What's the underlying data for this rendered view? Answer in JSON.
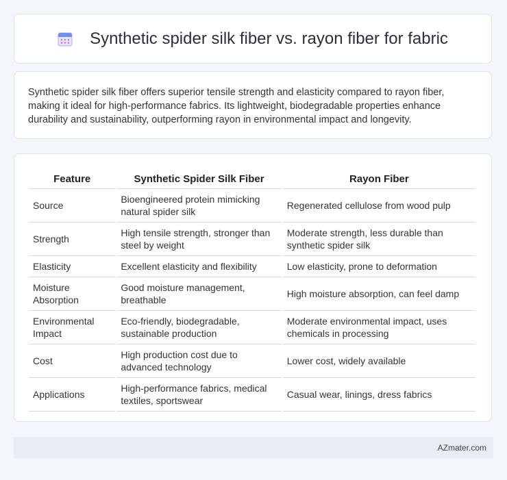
{
  "header": {
    "title": "Synthetic spider silk fiber vs. rayon fiber for fabric",
    "icon": "calendar-icon"
  },
  "summary": {
    "text": "Synthetic spider silk fiber offers superior tensile strength and elasticity compared to rayon fiber, making it ideal for high-performance fabrics. Its lightweight, biodegradable properties enhance durability and sustainability, outperforming rayon in environmental impact and longevity."
  },
  "table": {
    "headers": [
      "Feature",
      "Synthetic Spider Silk Fiber",
      "Rayon Fiber"
    ],
    "rows": [
      [
        "Source",
        "Bioengineered protein mimicking natural spider silk",
        "Regenerated cellulose from wood pulp"
      ],
      [
        "Strength",
        "High tensile strength, stronger than steel by weight",
        "Moderate strength, less durable than synthetic spider silk"
      ],
      [
        "Elasticity",
        "Excellent elasticity and flexibility",
        "Low elasticity, prone to deformation"
      ],
      [
        "Moisture Absorption",
        "Good moisture management, breathable",
        "High moisture absorption, can feel damp"
      ],
      [
        "Environmental Impact",
        "Eco-friendly, biodegradable, sustainable production",
        "Moderate environmental impact, uses chemicals in processing"
      ],
      [
        "Cost",
        "High production cost due to advanced technology",
        "Lower cost, widely available"
      ],
      [
        "Applications",
        "High-performance fabrics, medical textiles, sportswear",
        "Casual wear, linings, dress fabrics"
      ]
    ]
  },
  "footer": {
    "brand": "AZmater.com"
  },
  "colors": {
    "background": "#f3f6fb",
    "card": "#ffffff",
    "footer_bar": "#e7ecf5"
  }
}
